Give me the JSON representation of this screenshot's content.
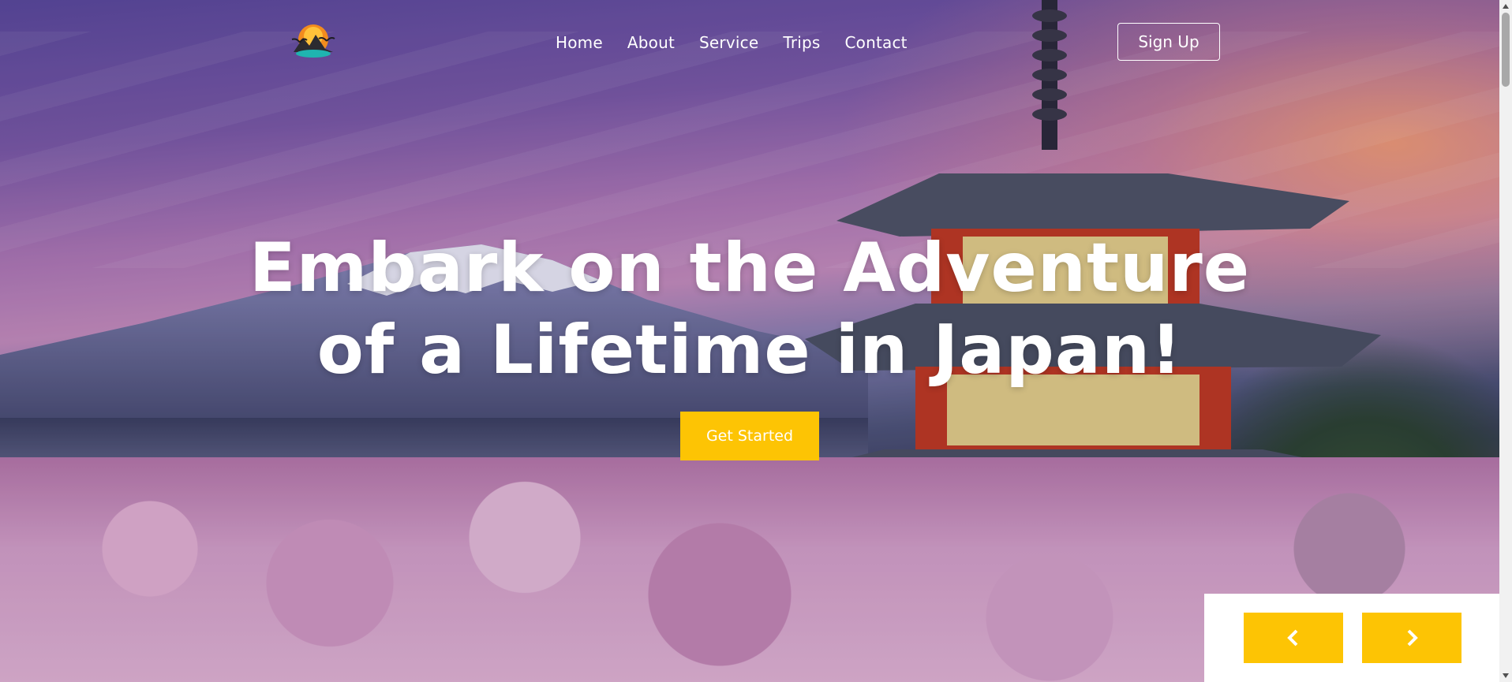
{
  "nav": {
    "links": [
      "Home",
      "About",
      "Service",
      "Trips",
      "Contact"
    ],
    "signup_label": "Sign Up"
  },
  "hero": {
    "headline_line1": "Embark on the Adventure",
    "headline_line2": "of a Lifetime in Japan!",
    "cta_label": "Get Started",
    "background_scene": "Mount Fuji with Chureito pagoda and cherry blossoms at sunset"
  },
  "slider": {
    "prev_icon": "chevron-left-icon",
    "next_icon": "chevron-right-icon"
  },
  "colors": {
    "accent": "#fdc404",
    "text": "#ffffff",
    "panel": "#ffffff"
  }
}
